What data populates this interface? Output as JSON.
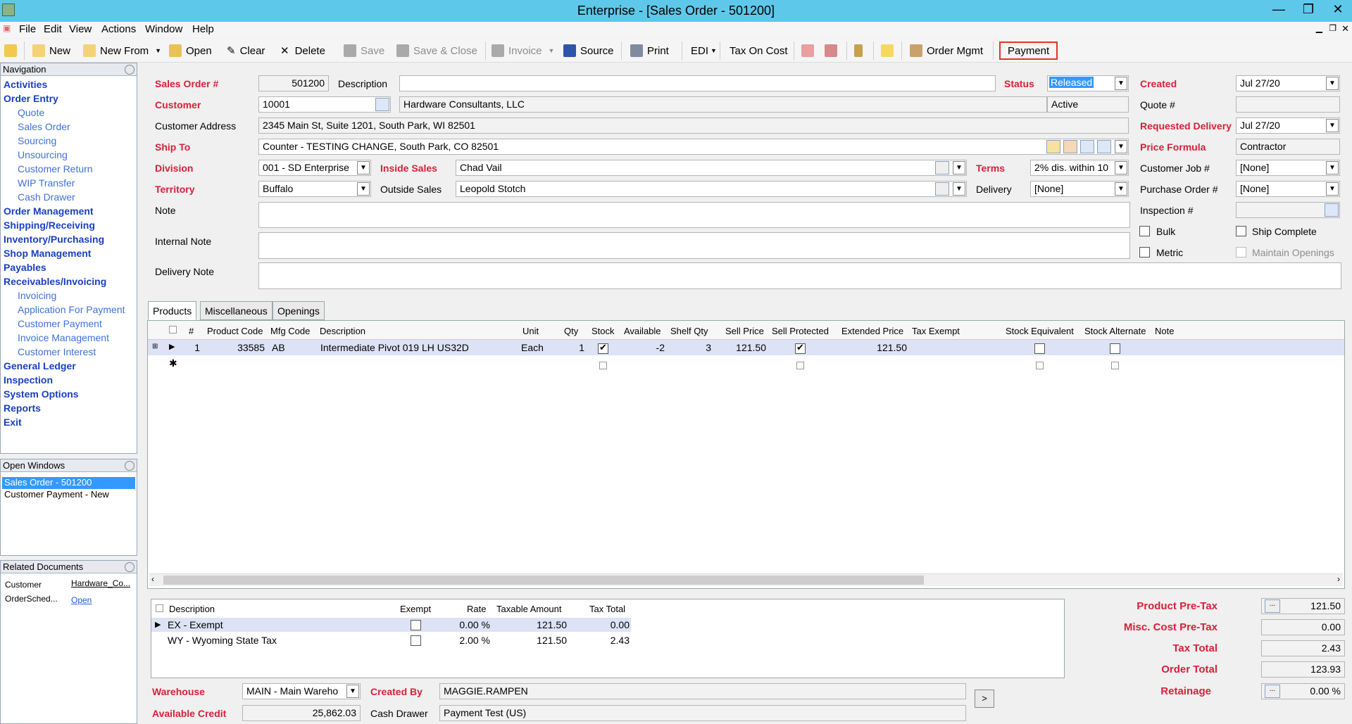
{
  "window": {
    "title": "Enterprise - [Sales Order - 501200]"
  },
  "menu": [
    "File",
    "Edit",
    "View",
    "Actions",
    "Window",
    "Help"
  ],
  "toolbar": {
    "new": "New",
    "new_from": "New From",
    "open": "Open",
    "clear": "Clear",
    "delete": "Delete",
    "save": "Save",
    "save_close": "Save & Close",
    "invoice": "Invoice",
    "source": "Source",
    "print": "Print",
    "edi": "EDI",
    "tax_on_cost": "Tax On Cost",
    "order_mgmt": "Order Mgmt",
    "payment": "Payment"
  },
  "nav": {
    "title": "Navigation",
    "items": [
      {
        "label": "Activities",
        "lvl": "b"
      },
      {
        "label": "Order Entry",
        "lvl": "b"
      },
      {
        "label": "Quote",
        "lvl": "s"
      },
      {
        "label": "Sales Order",
        "lvl": "s"
      },
      {
        "label": "Sourcing",
        "lvl": "s"
      },
      {
        "label": "Unsourcing",
        "lvl": "s"
      },
      {
        "label": "Customer Return",
        "lvl": "s"
      },
      {
        "label": "WIP Transfer",
        "lvl": "s"
      },
      {
        "label": "Cash Drawer",
        "lvl": "s"
      },
      {
        "label": "Order Management",
        "lvl": "b"
      },
      {
        "label": "Shipping/Receiving",
        "lvl": "b"
      },
      {
        "label": "Inventory/Purchasing",
        "lvl": "b"
      },
      {
        "label": "Shop Management",
        "lvl": "b"
      },
      {
        "label": "Payables",
        "lvl": "b"
      },
      {
        "label": "Receivables/Invoicing",
        "lvl": "b"
      },
      {
        "label": "Invoicing",
        "lvl": "s"
      },
      {
        "label": "Application For Payment",
        "lvl": "s"
      },
      {
        "label": "Customer Payment",
        "lvl": "s"
      },
      {
        "label": "Invoice Management",
        "lvl": "s"
      },
      {
        "label": "Customer Interest",
        "lvl": "s"
      },
      {
        "label": "General Ledger",
        "lvl": "b"
      },
      {
        "label": "Inspection",
        "lvl": "b"
      },
      {
        "label": "System Options",
        "lvl": "b"
      },
      {
        "label": "Reports",
        "lvl": "b"
      },
      {
        "label": "Exit",
        "lvl": "b"
      }
    ]
  },
  "open_windows": {
    "title": "Open Windows",
    "items": [
      "Sales Order - 501200",
      "Customer Payment - New"
    ]
  },
  "related": {
    "title": "Related Documents",
    "r1c1": "Customer",
    "r1c2": "Hardware_Co...",
    "r2c1": "OrderSched...",
    "r2c2": "Open"
  },
  "form": {
    "sales_order_label": "Sales Order #",
    "sales_order": "501200",
    "description_label": "Description",
    "description": "",
    "status_label": "Status",
    "status": "Released",
    "created_label": "Created",
    "created": "Jul 27/20",
    "customer_label": "Customer",
    "customer": "10001",
    "customer_name": "Hardware Consultants, LLC",
    "customer_state": "Active",
    "quote_label": "Quote #",
    "quote": "",
    "address_label": "Customer Address",
    "address": "2345 Main St, Suite 1201, South Park, WI  82501",
    "req_delivery_label": "Requested Delivery",
    "req_delivery": "Jul 27/20",
    "ship_to_label": "Ship To",
    "ship_to": "Counter - TESTING CHANGE, South Park, CO  82501",
    "price_formula_label": "Price Formula",
    "price_formula": "Contractor",
    "division_label": "Division",
    "division": "001 - SD Enterprise",
    "inside_sales_label": "Inside Sales",
    "inside_sales": "Chad Vail",
    "terms_label": "Terms",
    "terms": "2% dis. within 10",
    "customer_job_label": "Customer Job #",
    "customer_job": "[None]",
    "territory_label": "Territory",
    "territory": "Buffalo",
    "outside_sales_label": "Outside Sales",
    "outside_sales": "Leopold Stotch",
    "delivery_label": "Delivery",
    "delivery": "[None]",
    "po_label": "Purchase Order #",
    "po": "[None]",
    "note_label": "Note",
    "inspection_label": "Inspection #",
    "internal_note_label": "Internal Note",
    "delivery_note_label": "Delivery Note",
    "bulk_label": "Bulk",
    "ship_complete_label": "Ship Complete",
    "metric_label": "Metric",
    "maintain_openings_label": "Maintain Openings"
  },
  "tabs": [
    "Products",
    "Miscellaneous",
    "Openings"
  ],
  "grid": {
    "headers": [
      "#",
      "Product Code",
      "Mfg Code",
      "Description",
      "Unit",
      "Qty",
      "Stock",
      "Available",
      "Shelf Qty",
      "Sell Price",
      "Sell Protected",
      "Extended Price",
      "Tax Exempt",
      "Stock Equivalent",
      "Stock Alternate",
      "Note"
    ],
    "row": {
      "num": "1",
      "code": "33585",
      "mfg": "AB",
      "desc": "Intermediate Pivot 019 LH US32D",
      "unit": "Each",
      "qty": "1",
      "available": "-2",
      "shelf": "3",
      "sell": "121.50",
      "ext": "121.50"
    }
  },
  "tax": {
    "headers": [
      "Description",
      "Exempt",
      "Rate",
      "Taxable Amount",
      "Tax Total"
    ],
    "rows": [
      {
        "desc": "EX - Exempt",
        "rate": "0.00 %",
        "taxable": "121.50",
        "total": "0.00"
      },
      {
        "desc": "WY - Wyoming State Tax",
        "rate": "2.00 %",
        "taxable": "121.50",
        "total": "2.43"
      }
    ]
  },
  "totals": {
    "pretax_label": "Product Pre-Tax",
    "pretax": "121.50",
    "misc_label": "Misc. Cost Pre-Tax",
    "misc": "0.00",
    "tax_label": "Tax Total",
    "tax": "2.43",
    "order_label": "Order Total",
    "order": "123.93",
    "retainage_label": "Retainage",
    "retainage": "0.00 %"
  },
  "footer": {
    "warehouse_label": "Warehouse",
    "warehouse": "MAIN - Main Wareho",
    "created_by_label": "Created By",
    "created_by": "MAGGIE.RAMPEN",
    "credit_label": "Available Credit",
    "credit": "25,862.03",
    "cash_drawer_label": "Cash Drawer",
    "cash_drawer": "Payment Test (US)"
  },
  "colors": {
    "titlebar": "#5ec8ea",
    "required_label": "#d6203a",
    "nav_bold": "#1a3fc0",
    "nav_sub": "#3f72d8",
    "highlight": "#e5322d"
  }
}
